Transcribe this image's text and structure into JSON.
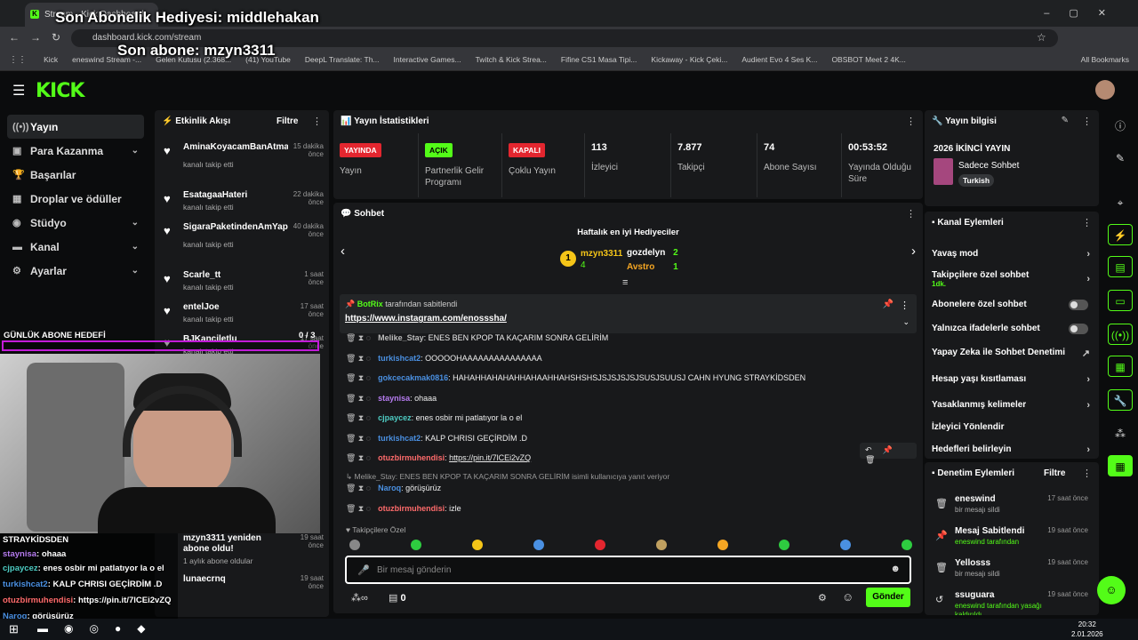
{
  "browser": {
    "tab_title": "Stream - Kick Dashboard",
    "url": "dashboard.kick.com/stream",
    "bookmarks": [
      "Kick",
      "eneswind Stream -...",
      "Gelen Kutusu (2.368...",
      "(41) YouTube",
      "DeepL Translate: Th...",
      "Interactive Games...",
      "Twitch & Kick Strea...",
      "Fifine CS1 Masa Tipi...",
      "Kickaway - Kick Çeki...",
      "Audient Evo 4 Ses K...",
      "OBSBOT Meet 2 4K..."
    ],
    "all_bookmarks": "All Bookmarks"
  },
  "overlay": {
    "gift": "Son Abonelik Hediyesi: middlehakan",
    "sub": "Son abone: mzyn3311",
    "goal_label": "GÜNLÜK ABONE HEDEFİ",
    "goal_value": "0 / 3"
  },
  "app": {
    "logo": "KICK",
    "sidebar": [
      {
        "label": "Yayın",
        "icon": "broadcast-icon",
        "glyph": "((•))",
        "active": true,
        "chev": false
      },
      {
        "label": "Para Kazanma",
        "icon": "money-icon",
        "glyph": "▣",
        "active": false,
        "chev": true
      },
      {
        "label": "Başarılar",
        "icon": "trophy-icon",
        "glyph": "🏆",
        "active": false,
        "chev": false
      },
      {
        "label": "Droplar ve ödüller",
        "icon": "gift-icon",
        "glyph": "▦",
        "active": false,
        "chev": false
      },
      {
        "label": "Stüdyo",
        "icon": "studio-icon",
        "glyph": "◉",
        "active": false,
        "chev": true
      },
      {
        "label": "Kanal",
        "icon": "channel-icon",
        "glyph": "▬",
        "active": false,
        "chev": true
      },
      {
        "label": "Ayarlar",
        "icon": "settings-icon",
        "glyph": "⚙",
        "active": false,
        "chev": true
      }
    ]
  },
  "feed": {
    "title": "Etkinlik Akışı",
    "filter": "Filtre",
    "items": [
      {
        "name": "AminaKoyacamBanAtmaArtik",
        "sub": "kanalı takip etti",
        "time": "15 dakika önce"
      },
      {
        "name": "EsatagaaHateri",
        "sub": "kanalı takip etti",
        "time": "22 dakika önce"
      },
      {
        "name": "SigaraPaketindenAmYapimi",
        "sub": "kanalı takip etti",
        "time": "40 dakika önce"
      },
      {
        "name": "Scarle_tt",
        "sub": "kanalı takip etti",
        "time": "1 saat önce"
      },
      {
        "name": "entelJoe",
        "sub": "kanalı takip etti",
        "time": "17 saat önce"
      },
      {
        "name": "BJKanciletlu",
        "sub": "kanalı takip etti",
        "time": "17 saat önce"
      }
    ],
    "lower": [
      {
        "name": "mzyn3311 yeniden abone oldu!",
        "sub": "1 aylık abone oldular",
        "time": "19 saat önce"
      },
      {
        "name": "lunaecrnq",
        "sub": "",
        "time": "19 saat önce"
      }
    ]
  },
  "stats": {
    "title": "Yayın İstatistikleri",
    "items": [
      {
        "badge": "YAYINDA",
        "color": "#e3262f",
        "label": "Yayın"
      },
      {
        "badge": "AÇIK",
        "color": "#53fc18",
        "label": "Partnerlik Gelir Programı"
      },
      {
        "badge": "KAPALI",
        "color": "#e3262f",
        "label": "Çoklu Yayın"
      },
      {
        "value": "113",
        "label": "İzleyici"
      },
      {
        "value": "7.877",
        "label": "Takipçi"
      },
      {
        "value": "74",
        "label": "Abone Sayısı"
      },
      {
        "value": "00:53:52",
        "label": "Yayında Olduğu Süre"
      }
    ]
  },
  "chat": {
    "title": "Sohbet",
    "gifters_title": "Haftalık en iyi Hediyeciler",
    "gifters": [
      {
        "name": "mzyn3311",
        "count": "4"
      },
      {
        "name": "gozdelyn",
        "count": "2"
      },
      {
        "name": "Avstro",
        "count": "1"
      }
    ],
    "pinned_by": "BotRix",
    "pinned_suffix": "tarafından sabitlendi",
    "pinned_link": "https://www.instagram.com/enosssha/",
    "messages": [
      {
        "user": "Melike_Stay",
        "color": "#bbbbbb",
        "text": "ENES BEN KPOP TA KAÇARIM SONRA GELİRİM"
      },
      {
        "user": "turkishcat2",
        "color": "#4a90e2",
        "text": "OOOOOHAAAAAAAAAAAAAAA"
      },
      {
        "user": "gokcecakmak0816",
        "color": "#4a90e2",
        "text": "HAHAHHAHAHAHHAHAAHHAHSHSHSJSJSJSJSJSUSJSUUSJ CAHN HYUNG STRAYKİDSDEN"
      },
      {
        "user": "staynisa",
        "color": "#b67cf0",
        "text": "ohaaa"
      },
      {
        "user": "cjpaycez",
        "color": "#4ecdc4",
        "text": "enes osbir mi patlatıyor la o el"
      },
      {
        "user": "turkishcat2",
        "color": "#4a90e2",
        "text": "KALP CHRISI GEÇİRDİM .D"
      },
      {
        "user": "otuzbirmuhendisi",
        "color": "#ff6b6b",
        "text": "https://pin.it/7lCEi2vZQ"
      }
    ],
    "reply_note": "Melike_Stay: ENES BEN KPOP TA KAÇARIM SONRA GELİRİM isimli kullanıcıya yanıt veriyor",
    "messages2": [
      {
        "user": "Naroq",
        "color": "#4a90e2",
        "text": "görüşürüz"
      },
      {
        "user": "otuzbirmuhendisi",
        "color": "#ff6b6b",
        "text": "izle"
      }
    ],
    "followers_label": "Takipçilere Özel",
    "input_placeholder": "Bir mesaj gönderin",
    "points": "0",
    "send": "Gönder"
  },
  "stream_info": {
    "title": "Yayın bilgisi",
    "stream_title": "2026 İKİNCİ YAYIN",
    "category": "Sadece Sohbet",
    "tag": "Turkish"
  },
  "channel_actions": {
    "title": "Kanal Eylemleri",
    "items": [
      {
        "label": "Yavaş mod",
        "type": "chev"
      },
      {
        "label": "Takipçilere özel sohbet",
        "sub": "1dk.",
        "type": "chev"
      },
      {
        "label": "Abonelere özel sohbet",
        "type": "toggle"
      },
      {
        "label": "Yalnızca ifadelerle sohbet",
        "type": "toggle"
      },
      {
        "label": "Yapay Zeka ile Sohbet Denetimi",
        "type": "ext"
      },
      {
        "label": "Hesap yaşı kısıtlaması",
        "type": "chev"
      },
      {
        "label": "Yasaklanmış kelimeler",
        "type": "chev"
      },
      {
        "label": "İzleyici Yönlendir",
        "type": "none"
      },
      {
        "label": "Hedefleri belirleyin",
        "type": "chev"
      }
    ]
  },
  "mod_actions": {
    "title": "Denetim Eylemleri",
    "filter": "Filtre",
    "items": [
      {
        "icon": "trash-icon",
        "glyph": "🗑",
        "name": "eneswind",
        "sub": "bir mesajı sildi",
        "time": "17 saat önce"
      },
      {
        "icon": "pin-icon",
        "glyph": "📌",
        "name": "Mesaj Sabitlendi",
        "sub": "eneswind tarafından",
        "time": "19 saat önce"
      },
      {
        "icon": "trash-icon",
        "glyph": "🗑",
        "name": "Yellosss",
        "sub": "bir mesajı sildi",
        "time": "19 saat önce"
      },
      {
        "icon": "undo-icon",
        "glyph": "↺",
        "name": "ssuguara",
        "sub": "eneswind tarafından yasağı kaldırıldı",
        "time": "19 saat önce"
      }
    ]
  },
  "overlay_chat": [
    {
      "user": "STRAYKİDSDEN",
      "color": "#ffffff",
      "text": ""
    },
    {
      "user": "staynisa",
      "color": "#b67cf0",
      "text": "ohaaa"
    },
    {
      "user": "cjpaycez",
      "color": "#4ecdc4",
      "text": "enes osbir mi patlatıyor la o el"
    },
    {
      "user": "turkishcat2",
      "color": "#4a90e2",
      "text": "KALP CHRISI GEÇİRDİM .D"
    },
    {
      "user": "otuzbirmuhendisi",
      "color": "#ff6b6b",
      "text": "https://pin.it/7lCEi2vZQ"
    },
    {
      "user": "Naroq",
      "color": "#4a90e2",
      "text": "görüşürüz"
    }
  ],
  "taskbar": {
    "time": "20:32",
    "date": "2.01.2026"
  }
}
